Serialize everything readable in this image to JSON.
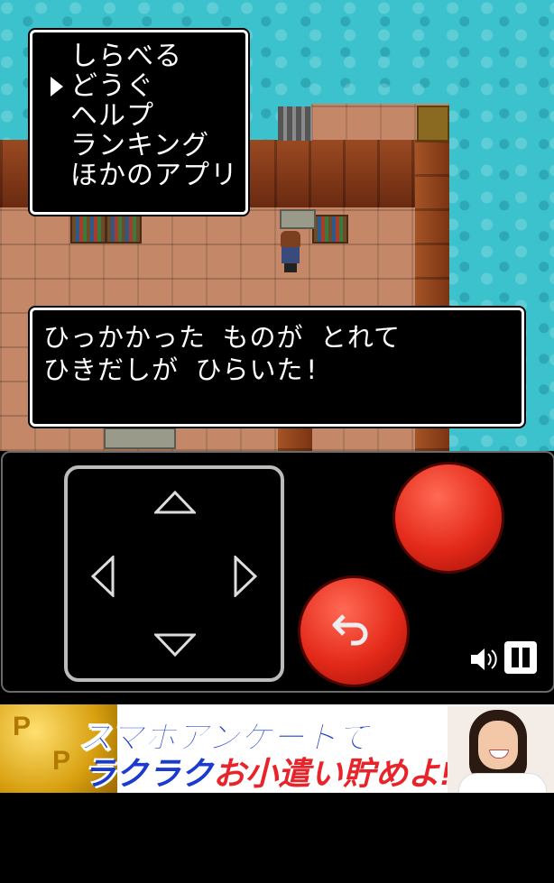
{
  "menu": {
    "items": [
      {
        "label": "しらべる"
      },
      {
        "label": "どうぐ"
      },
      {
        "label": "ヘルプ"
      },
      {
        "label": "ランキング"
      },
      {
        "label": "ほかのアプリ"
      }
    ],
    "selected_index": 1
  },
  "message": {
    "line1": "ひっかかった ものが とれて",
    "line2": "ひきだしが ひらいた!"
  },
  "controller": {
    "dpad_icons": [
      "arrow-up-icon",
      "arrow-left-icon",
      "arrow-right-icon",
      "arrow-down-icon"
    ],
    "a_button_color": "#e42a1a",
    "b_button_icon": "undo-icon",
    "volume_icon": "speaker-icon",
    "pause_icon": "pause-icon"
  },
  "ad": {
    "line1": "スマホアンケートで",
    "line2_prefix": "ラクラク",
    "line2_highlight": "お小遣い貯めよ!",
    "coin_mark": "P"
  }
}
